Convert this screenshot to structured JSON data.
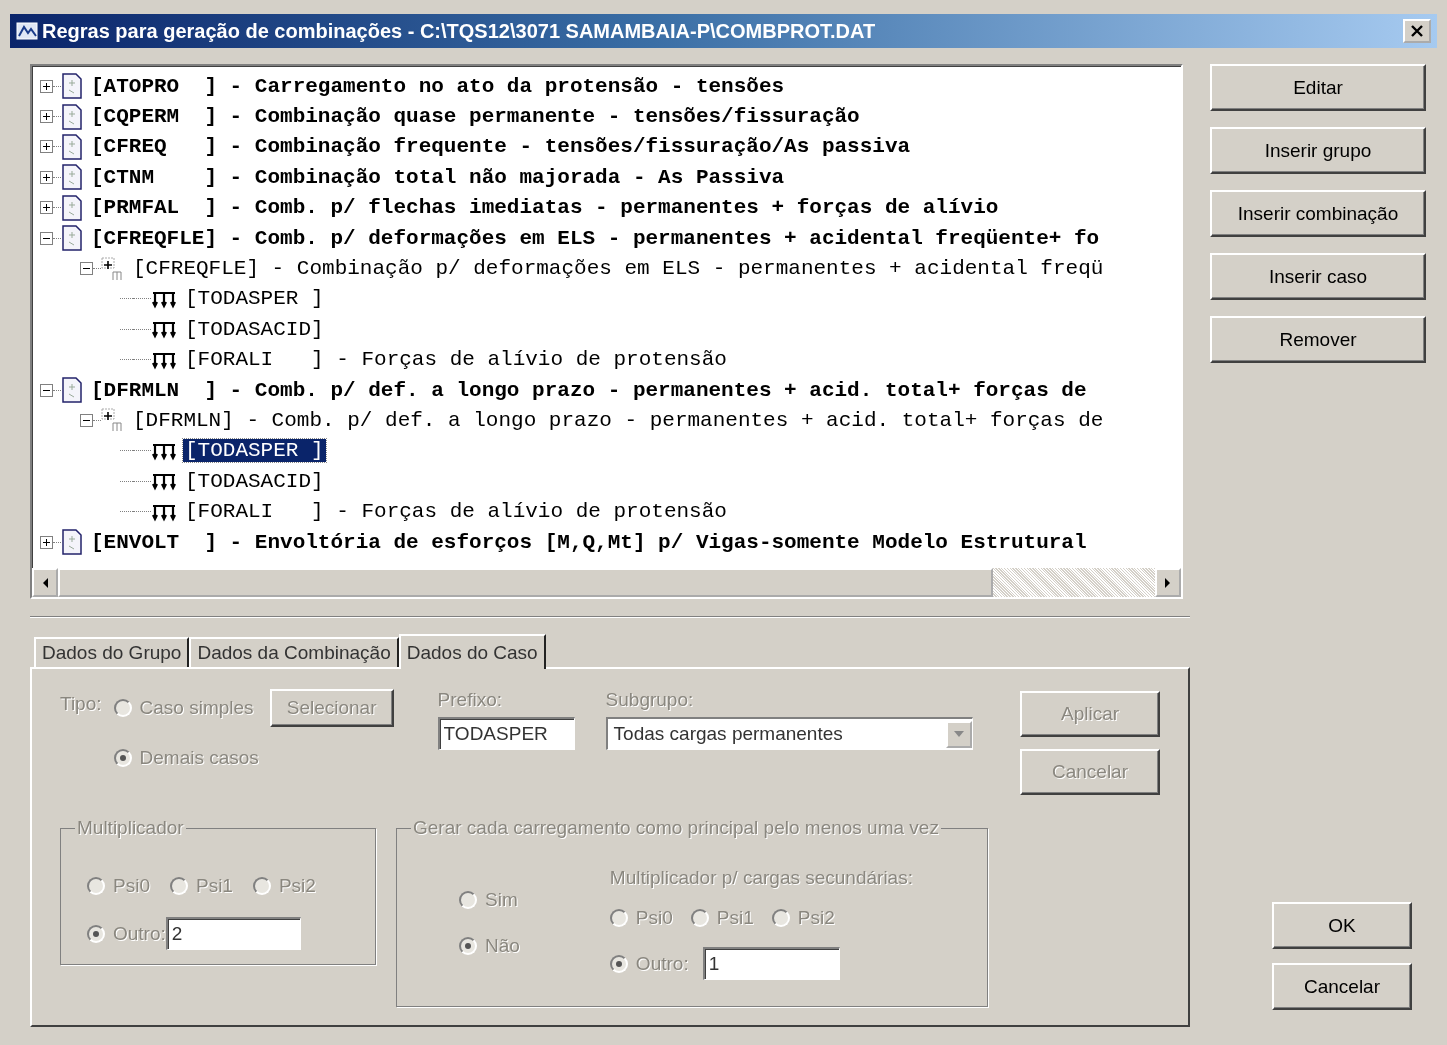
{
  "window": {
    "title": "Regras para geração de combinações - C:\\TQS12\\3071 SAMAMBAIA-P\\COMBPROT.DAT"
  },
  "tree": [
    {
      "kind": "group",
      "label": "[ATOPRO  ] - Carregamento no ato da protensão - tensões",
      "expanded": false,
      "selected": false
    },
    {
      "kind": "group",
      "label": "[CQPERM  ] - Combinação quase permanente - tensões/fissuração",
      "expanded": false,
      "selected": false
    },
    {
      "kind": "group",
      "label": "[CFREQ   ] - Combinação frequente - tensões/fissuração/As passiva",
      "expanded": false,
      "selected": false
    },
    {
      "kind": "group",
      "label": "[CTNM    ] - Combinação total não majorada - As Passiva",
      "expanded": false,
      "selected": false
    },
    {
      "kind": "group",
      "label": "[PRMFAL  ] - Comb. p/ flechas imediatas - permanentes + forças de alívio",
      "expanded": false,
      "selected": false
    },
    {
      "kind": "group",
      "label": "[CFREQFLE] - Comb. p/ deformações em ELS - permanentes + acidental freqüente+ fo",
      "expanded": true,
      "selected": false,
      "children": [
        {
          "kind": "combination",
          "label": "[CFREQFLE] - Combinação p/ deformações em ELS - permanentes + acidental freqü",
          "expanded": true,
          "selected": false,
          "children": [
            {
              "kind": "case",
              "label": "[TODASPER ]",
              "selected": false
            },
            {
              "kind": "case",
              "label": "[TODASACID]",
              "selected": false
            },
            {
              "kind": "case",
              "label": "[FORALI   ] - Forças de alívio de protensão",
              "selected": false
            }
          ]
        }
      ]
    },
    {
      "kind": "group",
      "label": "[DFRMLN  ] - Comb. p/ def. a longo prazo - permanentes + acid. total+ forças de",
      "expanded": true,
      "selected": false,
      "children": [
        {
          "kind": "combination",
          "label": "[DFRMLN] - Comb. p/ def. a longo prazo - permanentes + acid. total+ forças de",
          "expanded": true,
          "selected": false,
          "children": [
            {
              "kind": "case",
              "label": "[TODASPER ]",
              "selected": true
            },
            {
              "kind": "case",
              "label": "[TODASACID]",
              "selected": false
            },
            {
              "kind": "case",
              "label": "[FORALI   ] - Forças de alívio de protensão",
              "selected": false
            }
          ]
        }
      ]
    },
    {
      "kind": "group",
      "label": "[ENVOLT  ] - Envoltória de esforços [M,Q,Mt] p/ Vigas-somente Modelo Estrutural",
      "expanded": false,
      "selected": false
    }
  ],
  "side_buttons": [
    "Editar",
    "Inserir grupo",
    "Inserir combinação",
    "Inserir caso",
    "Remover"
  ],
  "tabs": [
    {
      "label": "Dados do Grupo",
      "selected": false
    },
    {
      "label": "Dados da Combinação",
      "selected": false
    },
    {
      "label": "Dados do Caso",
      "selected": true
    }
  ],
  "case_panel": {
    "disabled": true,
    "type_label": "Tipo:",
    "type_options": [
      {
        "label": "Caso simples",
        "checked": false
      },
      {
        "label": "Demais casos",
        "checked": true
      }
    ],
    "select_button": "Selecionar",
    "prefix": {
      "label": "Prefixo:",
      "value": "TODASPER"
    },
    "subgroup": {
      "label": "Subgrupo:",
      "value": "Todas cargas permanentes"
    },
    "multiplier": {
      "title": "Multiplicador",
      "options": [
        {
          "label": "Psi0",
          "checked": false
        },
        {
          "label": "Psi1",
          "checked": false
        },
        {
          "label": "Psi2",
          "checked": false
        }
      ],
      "other": {
        "label": "Outro:",
        "checked": true,
        "value": "2"
      }
    },
    "principal": {
      "title": "Gerar cada carregamento como principal pelo menos uma vez",
      "options": [
        {
          "label": "Sim",
          "checked": false
        },
        {
          "label": "Não",
          "checked": true
        }
      ],
      "secondary": {
        "label": "Multiplicador p/ cargas secundárias:",
        "options": [
          {
            "label": "Psi0",
            "checked": false
          },
          {
            "label": "Psi1",
            "checked": false
          },
          {
            "label": "Psi2",
            "checked": false
          }
        ],
        "other": {
          "label": "Outro:",
          "checked": true,
          "value": "1"
        }
      }
    },
    "buttons": [
      "Aplicar",
      "Cancelar"
    ]
  },
  "dialog_buttons": [
    "OK",
    "Cancelar"
  ]
}
